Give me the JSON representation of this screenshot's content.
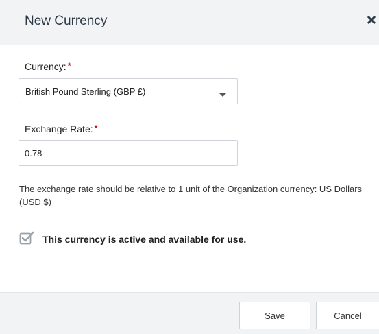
{
  "dialog": {
    "title": "New Currency",
    "close_icon": "close-icon"
  },
  "currency": {
    "label": "Currency:",
    "required_mark": "*",
    "selected": "British Pound Sterling (GBP £)",
    "caret_icon": "caret-down-icon"
  },
  "exchange_rate": {
    "label": "Exchange Rate:",
    "required_mark": "*",
    "value": "0.78"
  },
  "help_text": "The exchange rate should be relative to 1 unit of the Organization currency: US Dollars (USD $)",
  "active_checkbox": {
    "checked": true,
    "label": "This currency is active and available for use.",
    "icon": "checkbox-checked-icon"
  },
  "footer": {
    "save_label": "Save",
    "cancel_label": "Cancel"
  },
  "colors": {
    "header_bg": "#f2f3f4",
    "required": "#d0021b",
    "checkbox": "#9aa1a8"
  }
}
